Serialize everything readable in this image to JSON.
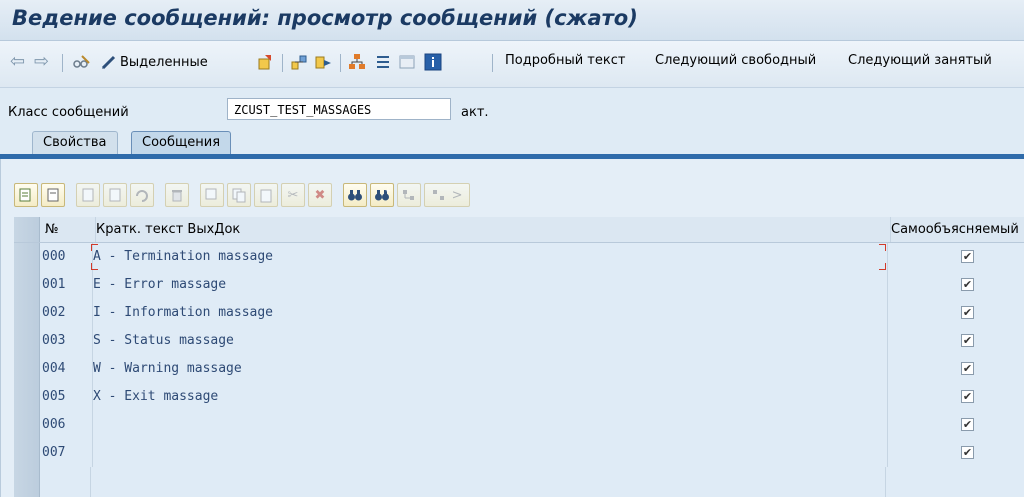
{
  "window": {
    "title": "Ведение сообщений: просмотр сообщений (сжато)"
  },
  "toolbar": {
    "highlighted_label": "Выделенные",
    "detail_text_label": "Подробный текст",
    "next_free_label": "Следующий свободный",
    "next_used_label": "Следующий занятый"
  },
  "form": {
    "message_class_label": "Класс сообщений",
    "message_class_value": "ZCUST_TEST_MASSAGES",
    "status": "акт."
  },
  "tabs": [
    {
      "label": "Свойства",
      "active": false
    },
    {
      "label": "Сообщения",
      "active": true
    }
  ],
  "grid": {
    "columns": [
      "№",
      "Кратк. текст ВыхДок",
      "Самообъясняемый"
    ],
    "rows": [
      {
        "num": "000",
        "text": "A - Termination massage",
        "self_explanatory": true
      },
      {
        "num": "001",
        "text": "E - Error massage",
        "self_explanatory": true
      },
      {
        "num": "002",
        "text": "I - Information massage",
        "self_explanatory": true
      },
      {
        "num": "003",
        "text": "S - Status massage",
        "self_explanatory": true
      },
      {
        "num": "004",
        "text": "W - Warning massage",
        "self_explanatory": true
      },
      {
        "num": "005",
        "text": "X - Exit massage",
        "self_explanatory": true
      },
      {
        "num": "006",
        "text": "",
        "self_explanatory": true
      },
      {
        "num": "007",
        "text": "",
        "self_explanatory": true
      }
    ]
  },
  "colors": {
    "title": "#1b3a63",
    "tab_accent": "#2f6baa",
    "grid_text": "#2e4a75",
    "focus": "#d23a2a"
  }
}
